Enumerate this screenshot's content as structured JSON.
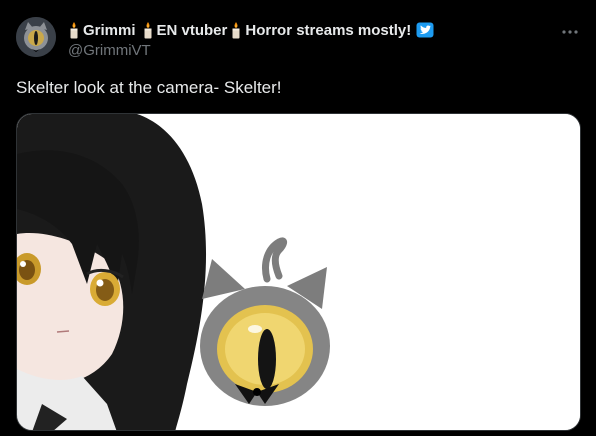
{
  "author": {
    "name_segments": [
      "Grimmi",
      "EN vtuber",
      "Horror streams mostly!"
    ],
    "handle": "@GrimmiVT",
    "verified_color": "#1d9bf0"
  },
  "tweet": {
    "text": "Skelter look at the camera- Skelter!"
  },
  "media": {
    "background": "#ffffff"
  },
  "icons": {
    "avatar": "cat-avatar",
    "candle": "candle-emoji",
    "verified": "twitter-verified-badge",
    "more": "more-icon"
  }
}
